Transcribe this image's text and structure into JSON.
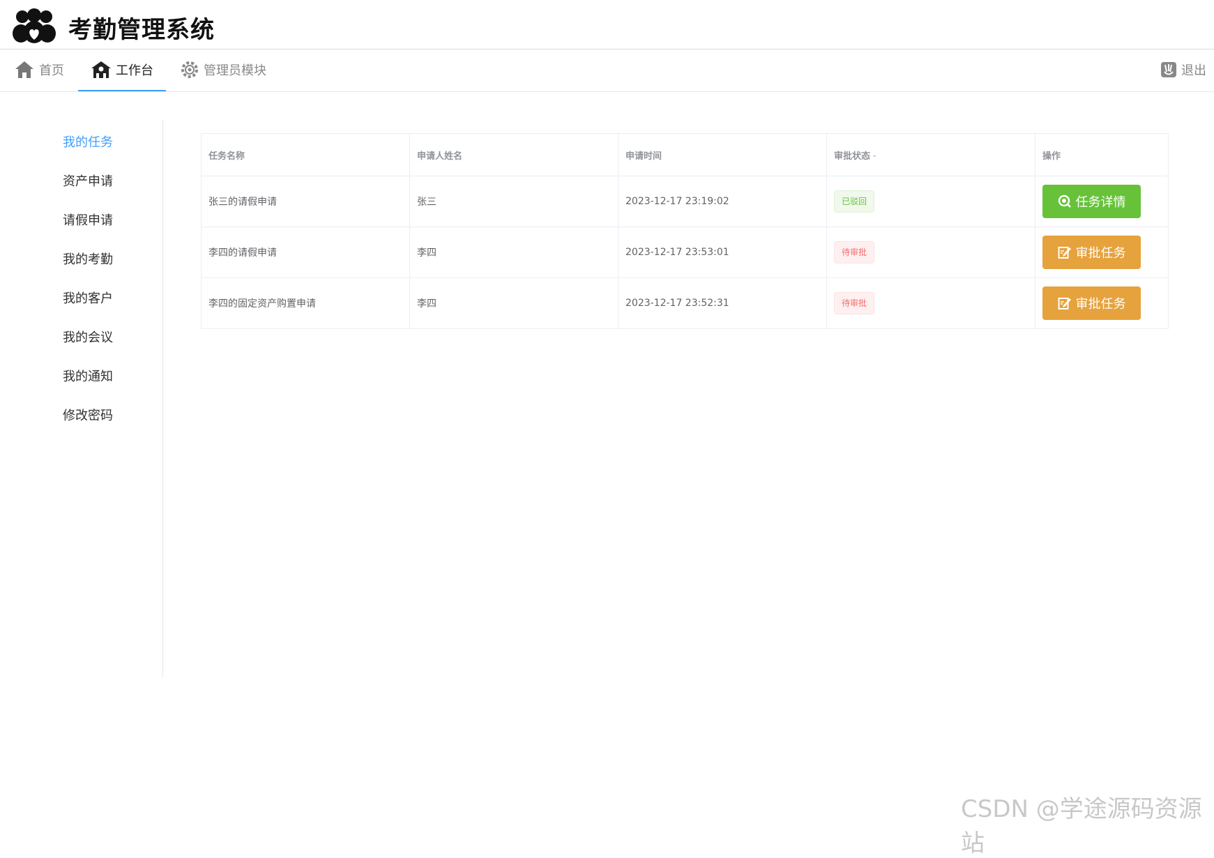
{
  "header": {
    "app_title": "考勤管理系统",
    "logo_icon": "users-heart-icon"
  },
  "nav": {
    "home": "首页",
    "workbench": "工作台",
    "admin": "管理员模块",
    "logout": "退出",
    "active_color": "#409eff"
  },
  "sidebar": {
    "items": [
      {
        "label": "我的任务",
        "active": true
      },
      {
        "label": "资产申请"
      },
      {
        "label": "请假申请"
      },
      {
        "label": "我的考勤"
      },
      {
        "label": "我的客户"
      },
      {
        "label": "我的会议"
      },
      {
        "label": "我的通知"
      },
      {
        "label": "修改密码"
      }
    ]
  },
  "table": {
    "columns": [
      "任务名称",
      "申请人姓名",
      "申请时间",
      "审批状态",
      "操作"
    ],
    "sort_caret": "⌄",
    "rows": [
      {
        "task": "张三的请假申请",
        "applicant": "张三",
        "time": "2023-12-17 23:19:02",
        "status": "已驳回",
        "status_type": "success",
        "action": "任务详情",
        "action_color": "#67c23a",
        "action_icon": "search-icon"
      },
      {
        "task": "李四的请假申请",
        "applicant": "李四",
        "time": "2023-12-17 23:53:01",
        "status": "待审批",
        "status_type": "danger",
        "action": "审批任务",
        "action_color": "#e6a23c",
        "action_icon": "edit-icon"
      },
      {
        "task": "李四的固定资产购置申请",
        "applicant": "李四",
        "time": "2023-12-17 23:52:31",
        "status": "待审批",
        "status_type": "danger",
        "action": "审批任务",
        "action_color": "#e6a23c",
        "action_icon": "edit-icon"
      }
    ]
  },
  "watermark": "CSDN @学途源码资源站"
}
